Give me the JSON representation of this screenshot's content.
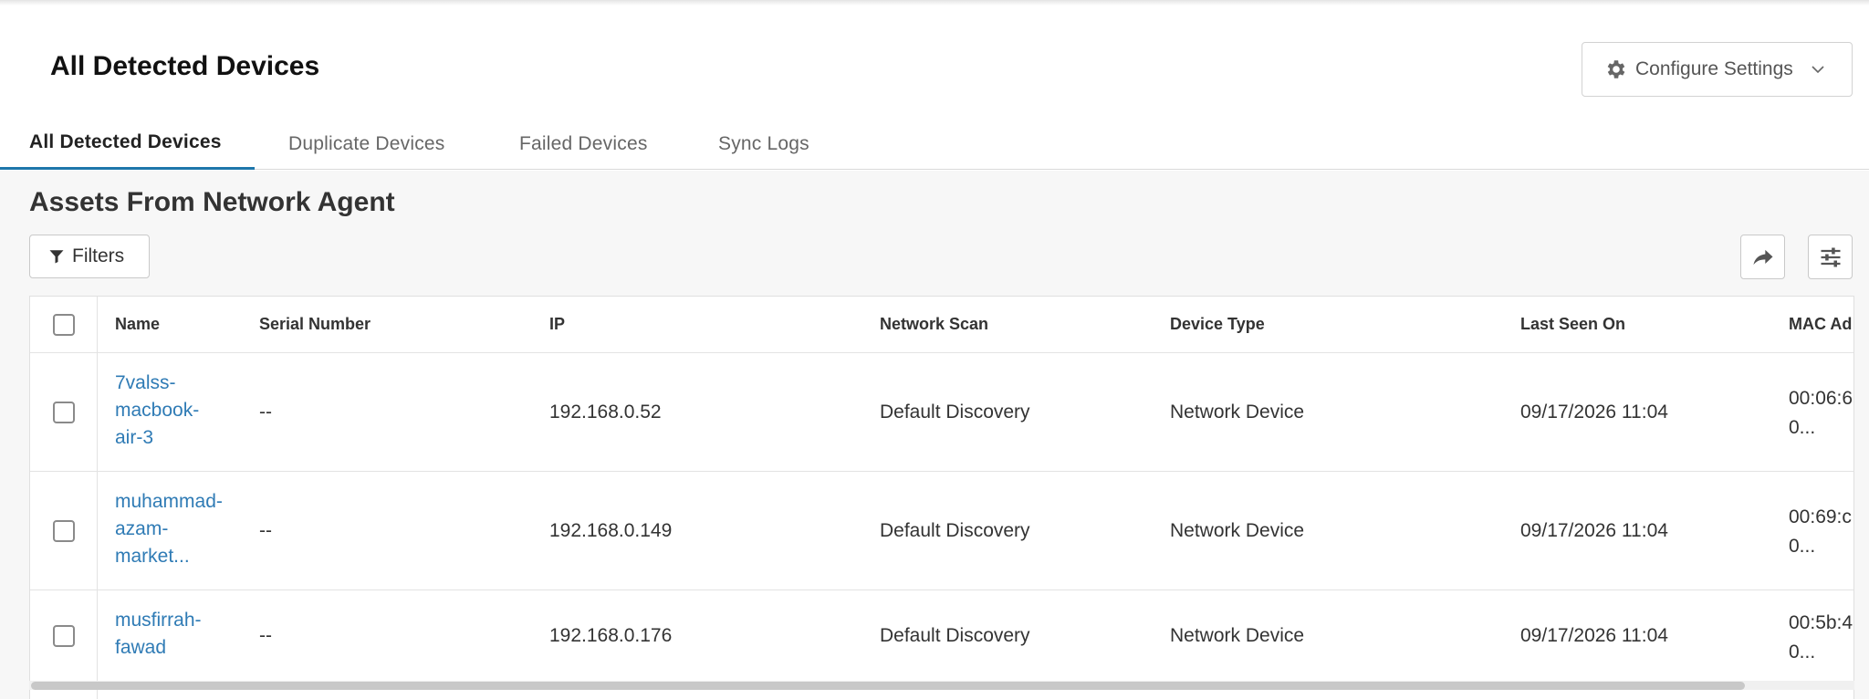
{
  "header": {
    "title": "All Detected Devices",
    "configure_label": "Configure Settings"
  },
  "tabs": [
    {
      "label": "All Detected Devices",
      "active": true
    },
    {
      "label": "Duplicate Devices",
      "active": false
    },
    {
      "label": "Failed Devices",
      "active": false
    },
    {
      "label": "Sync Logs",
      "active": false
    }
  ],
  "section": {
    "title": "Assets From Network Agent",
    "filters_label": "Filters"
  },
  "table": {
    "columns": [
      "Name",
      "Serial Number",
      "IP",
      "Network Scan",
      "Device Type",
      "Last Seen On",
      "MAC Ad"
    ],
    "rows": [
      {
        "name": "7valss-\nmacbook-\nair-3",
        "serial": "--",
        "ip": "192.168.0.52",
        "scan": "Default Discovery",
        "type": "Network Device",
        "last_seen": "09/17/2026 11:04",
        "mac": "00:06:6\n0..."
      },
      {
        "name": "muhammad-\nazam-\nmarket...",
        "serial": "--",
        "ip": "192.168.0.149",
        "scan": "Default Discovery",
        "type": "Network Device",
        "last_seen": "09/17/2026 11:04",
        "mac": "00:69:c\n0..."
      },
      {
        "name": "musfirrah-\nfawad",
        "serial": "--",
        "ip": "192.168.0.176",
        "scan": "Default Discovery",
        "type": "Network Device",
        "last_seen": "09/17/2026 11:04",
        "mac": "00:5b:4\n0..."
      }
    ]
  },
  "colors": {
    "accent": "#1e76ab",
    "link": "#2f7bb5"
  },
  "icons": {
    "configure": "gear-icon",
    "dropdown": "chevron-down-icon",
    "filters": "filter-icon",
    "export": "share-arrow-icon",
    "columns": "sliders-icon"
  }
}
